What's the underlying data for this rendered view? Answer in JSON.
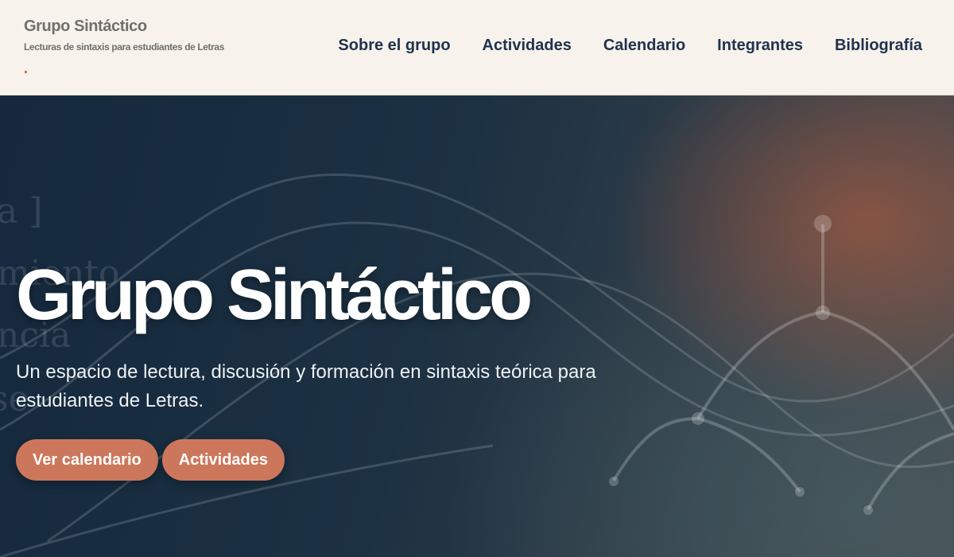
{
  "brand": {
    "title": "Grupo Sintáctico",
    "tagline": "Lecturas de sintaxis para estudiantes de Letras",
    "dot": "."
  },
  "nav": {
    "items": [
      "Sobre el grupo",
      "Actividades",
      "Calendario",
      "Integrantes",
      "Bibliografía"
    ]
  },
  "hero": {
    "title": "Grupo Sintáctico",
    "subtitle": "Un espacio de lectura, discusión y formación en sintaxis teórica para estudiantes de Letras.",
    "background_words": [
      "a ]",
      "miento",
      "ncia",
      "se"
    ],
    "buttons": [
      "Ver calendario",
      "Actividades"
    ]
  },
  "colors": {
    "header_bg": "#f7f3ec",
    "nav_text": "#21324d",
    "accent": "#cc775b",
    "hero_dark": "#15283d"
  }
}
